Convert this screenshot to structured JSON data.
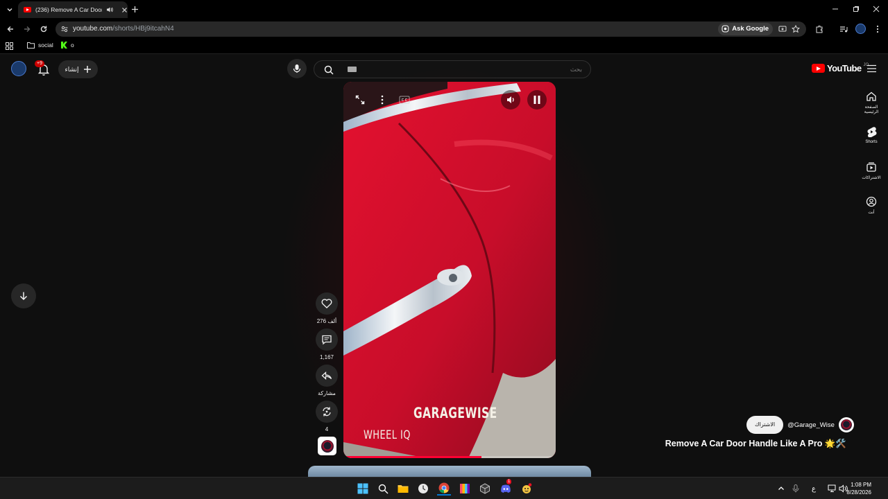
{
  "browser": {
    "tab_title": "(236) Remove A Car Door Handle Like A Pro",
    "url_host": "youtube.com",
    "url_path": "/shorts/HBj9itcahN4",
    "ask_google": "Ask Google",
    "bookmarks": [
      {
        "label": "social"
      },
      {
        "label": "o"
      }
    ]
  },
  "youtube": {
    "create_label": "إنشاء",
    "notification_badge": "+9",
    "search_placeholder": "بحث",
    "logo_text": "YouTube",
    "logo_region": "JO",
    "sidebar": [
      {
        "label": "الصفحة الرئيسية",
        "icon": "home-icon"
      },
      {
        "label": "Shorts",
        "icon": "shorts-icon"
      },
      {
        "label": "الاشتراكات",
        "icon": "subscriptions-icon"
      },
      {
        "label": "أنت",
        "icon": "you-icon"
      }
    ]
  },
  "short": {
    "overlay_brand": "GARAGEWISE",
    "overlay_sub": "WHEEL IQ",
    "progress": 0.65,
    "likes": "276 ألف",
    "comments": "1,167",
    "share_label": "مشاركة",
    "remix_count": "4",
    "channel": "@Garage_Wise",
    "subscribe_label": "الاشتراك",
    "title": "Remove A Car Door Handle Like A Pro 🌟🛠️"
  },
  "taskbar": {
    "time": "1:08 PM",
    "date": "8/28/2026",
    "lang": "ع",
    "discord_badge": "1",
    "accent": "#0078d4"
  },
  "colors": {
    "youtube_red": "#ff0000",
    "car_red": "#c8102e",
    "bg": "#0f0f0f"
  }
}
